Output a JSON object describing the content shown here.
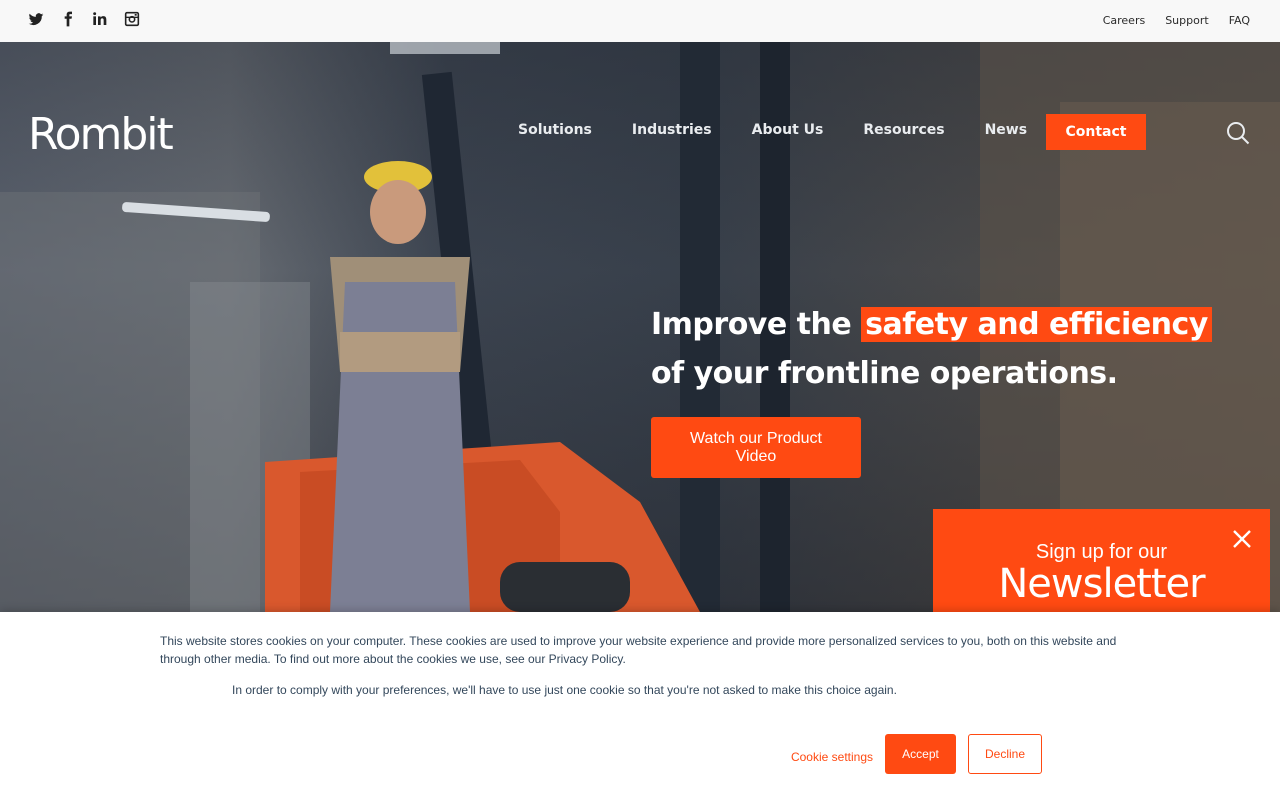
{
  "brand": {
    "name": "Rombit",
    "accent": "#ff4a12"
  },
  "social": [
    {
      "icon": "twitter-icon"
    },
    {
      "icon": "facebook-icon"
    },
    {
      "icon": "linkedin-icon"
    },
    {
      "icon": "instagram-icon"
    }
  ],
  "utility_nav": {
    "careers": "Careers",
    "support": "Support",
    "faq": "FAQ"
  },
  "nav": {
    "solutions": "Solutions",
    "industries": "Industries",
    "about": "About Us",
    "resources": "Resources",
    "news": "News",
    "contact": "Contact",
    "search_icon": "search-icon"
  },
  "hero": {
    "headline_pre": "Improve the",
    "headline_highlight": "safety and efficiency",
    "headline_post": "of your frontline operations.",
    "cta": "Watch our Product Video"
  },
  "newsletter": {
    "subtitle": "Sign up for our",
    "title": "Newsletter",
    "close_icon": "close-icon"
  },
  "cookie": {
    "text": "This website stores cookies on your computer. These cookies are used to improve your website experience and provide more personalized services to you, both on this website and through other media. To find out more about the cookies we use, see our Privacy Policy.",
    "text2": "In order to comply with your preferences, we'll have to use just one cookie so that you're not asked to make this choice again.",
    "settings": "Cookie settings",
    "accept": "Accept",
    "decline": "Decline"
  }
}
